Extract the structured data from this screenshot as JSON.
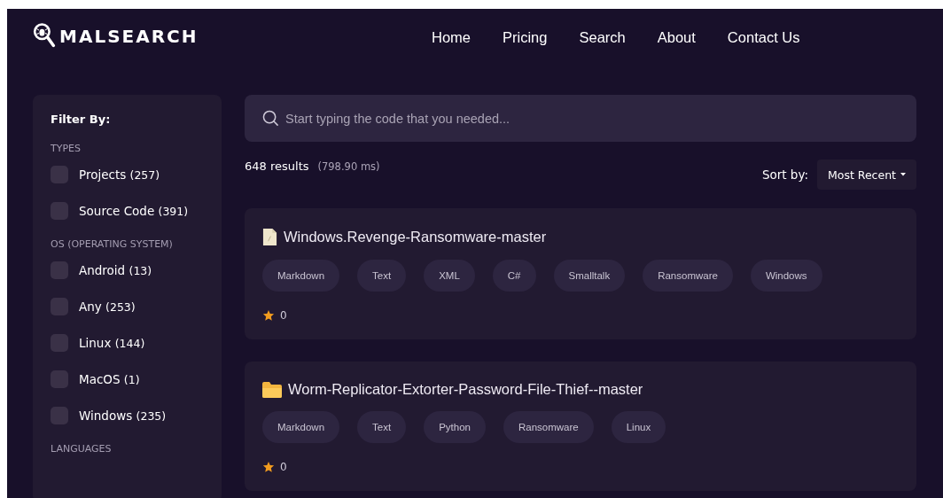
{
  "logo": {
    "text": "MALSEARCH"
  },
  "nav": [
    {
      "label": "Home"
    },
    {
      "label": "Pricing"
    },
    {
      "label": "Search"
    },
    {
      "label": "About"
    },
    {
      "label": "Contact Us"
    }
  ],
  "sidebar": {
    "title": "Filter By:",
    "sections": [
      {
        "heading": "TYPES",
        "options": [
          {
            "label": "Projects",
            "count": "(257)",
            "checked": false
          },
          {
            "label": "Source Code",
            "count": "(391)",
            "checked": false
          }
        ]
      },
      {
        "heading": "OS (OPERATING SYSTEM)",
        "options": [
          {
            "label": "Android",
            "count": "(13)",
            "checked": false
          },
          {
            "label": "Any",
            "count": "(253)",
            "checked": false
          },
          {
            "label": "Linux",
            "count": "(144)",
            "checked": false
          },
          {
            "label": "MacOS",
            "count": "(1)",
            "checked": false
          },
          {
            "label": "Windows",
            "count": "(235)",
            "checked": false
          }
        ]
      },
      {
        "heading": "LANGUAGES"
      }
    ]
  },
  "search": {
    "placeholder": "Start typing the code that you needed..."
  },
  "results_summary": {
    "count": "648 results",
    "time": "(798.90 ms)"
  },
  "sort": {
    "label": "Sort by:",
    "value": "Most Recent"
  },
  "results": [
    {
      "kind": "file",
      "title": "Windows.Revenge-Ransomware-master",
      "tags": [
        "Markdown",
        "Text",
        "XML",
        "C#",
        "Smalltalk",
        "Ransomware",
        "Windows"
      ],
      "stars_text": "0"
    },
    {
      "kind": "folder",
      "title": "Worm-Replicator-Extorter-Password-File-Thief--master",
      "tags": [
        "Markdown",
        "Text",
        "Python",
        "Ransomware",
        "Linux"
      ],
      "stars_text": "0"
    }
  ]
}
